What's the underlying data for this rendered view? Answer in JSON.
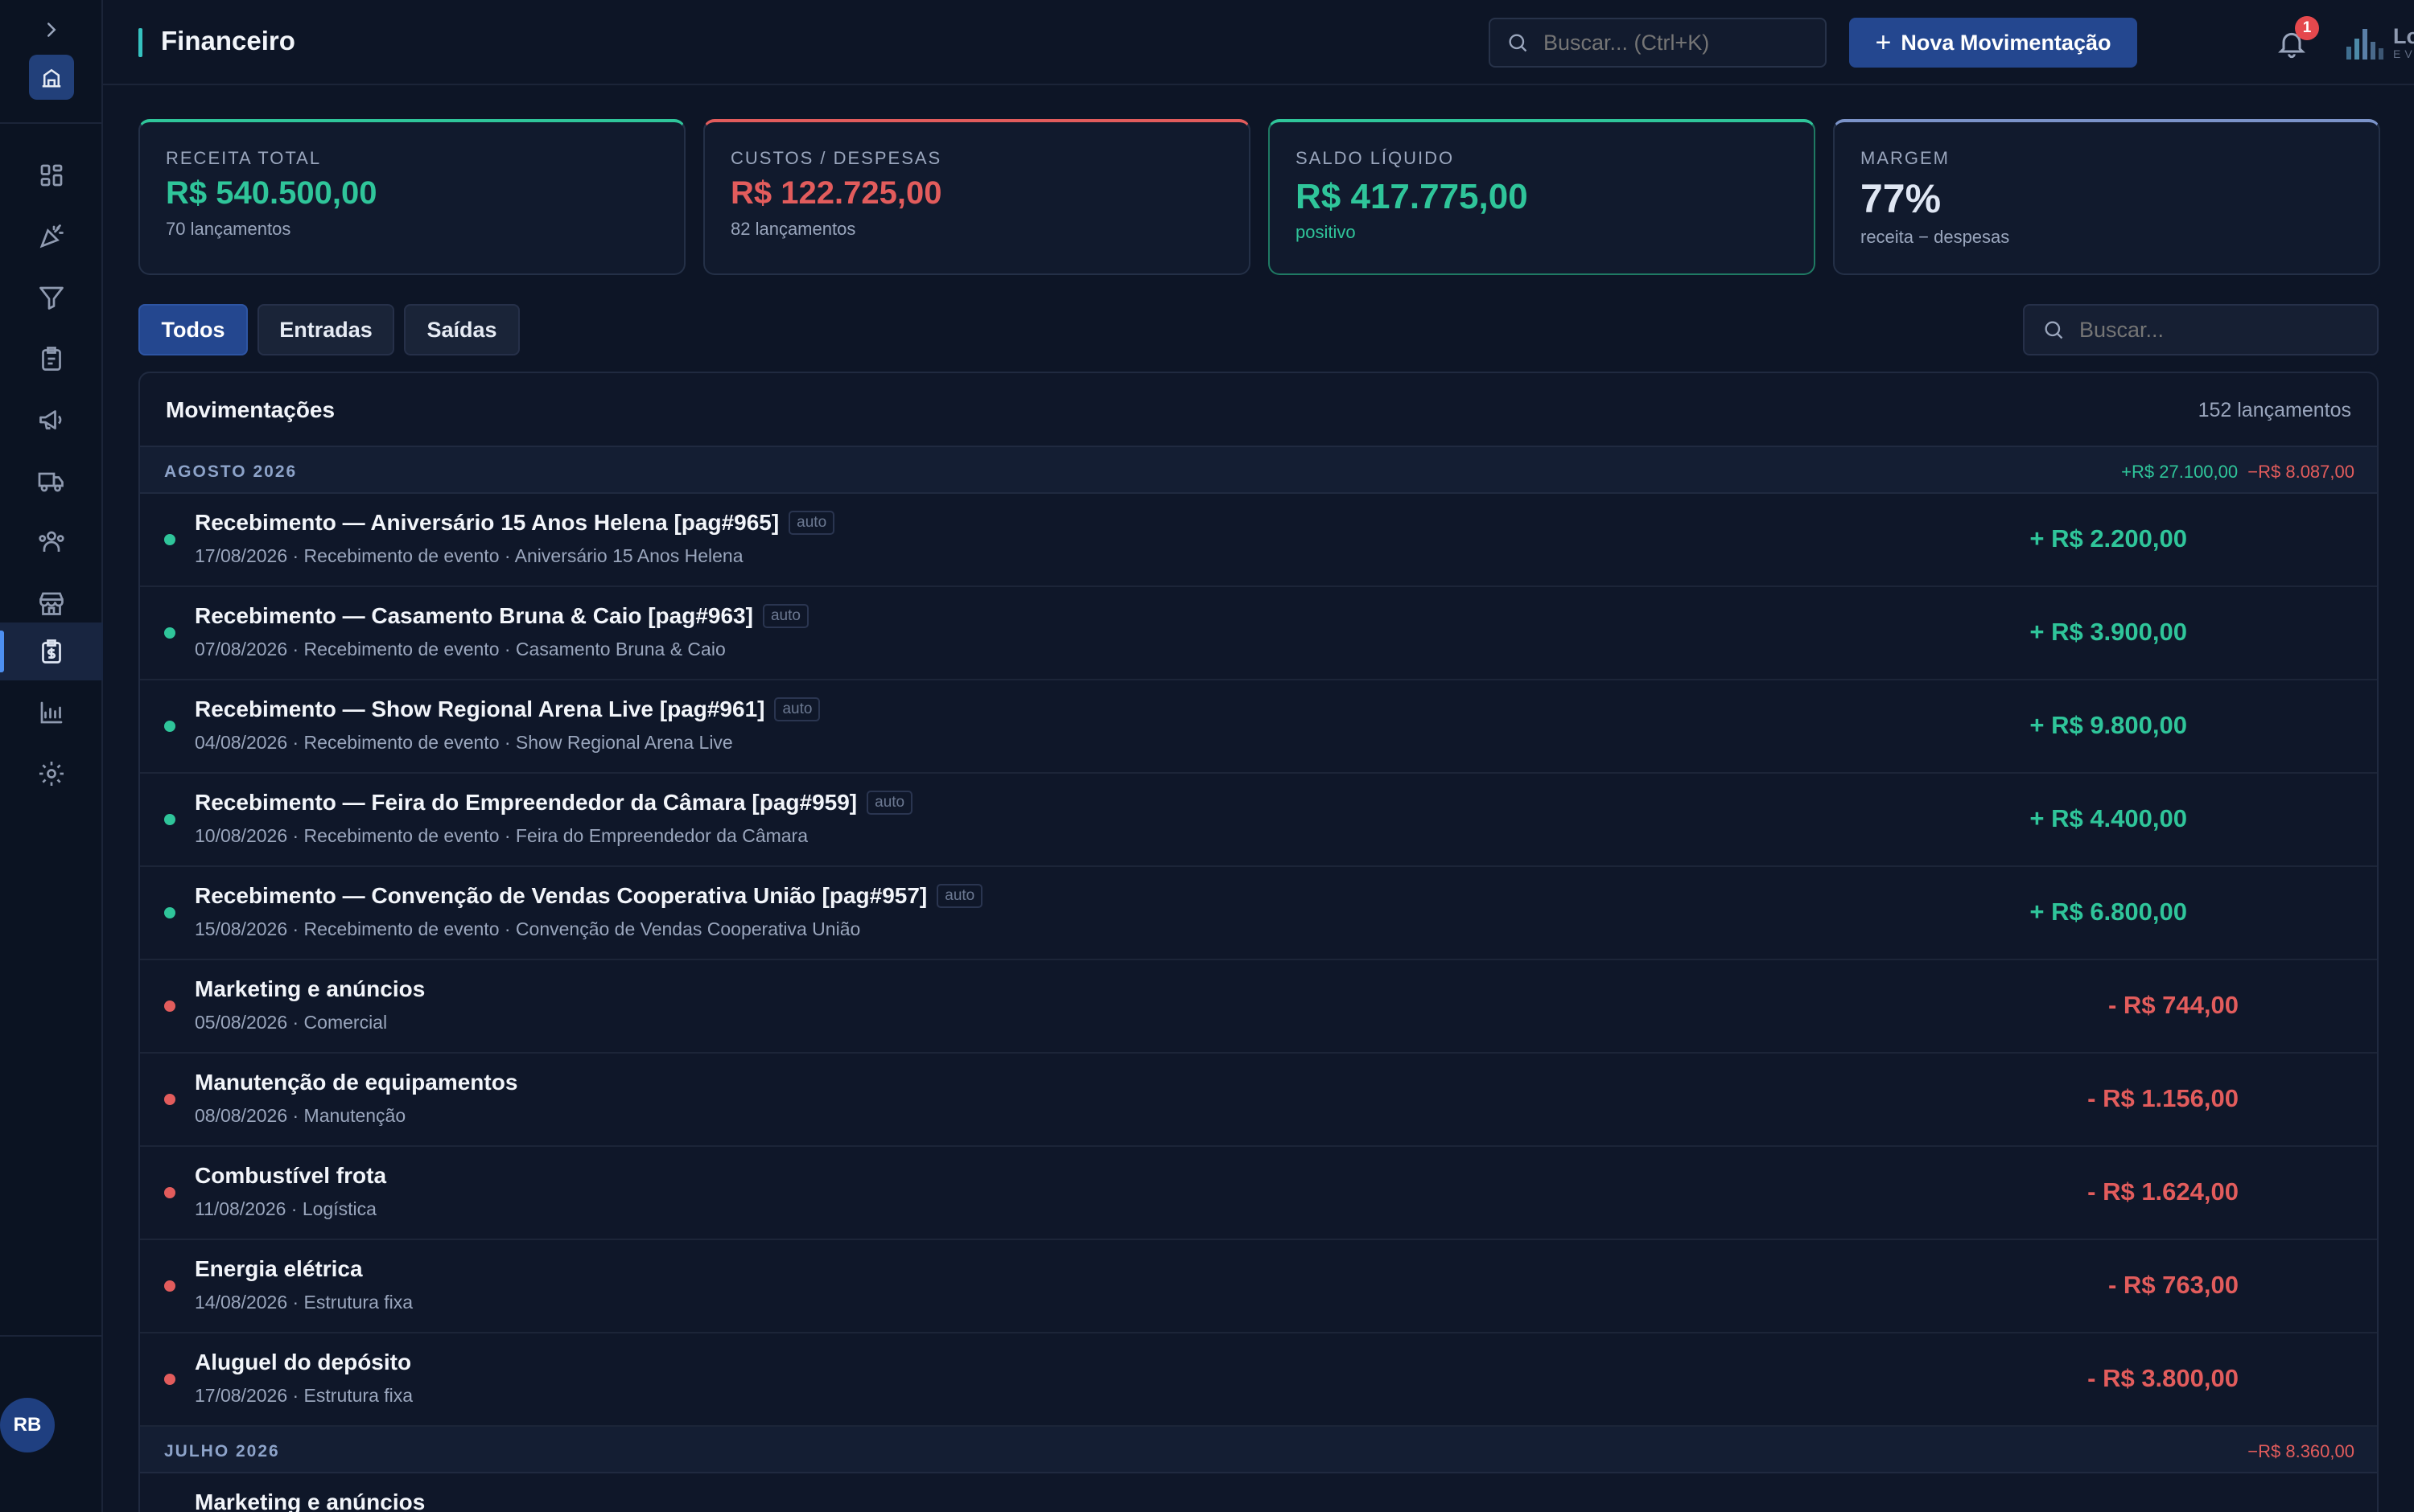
{
  "header": {
    "title": "Financeiro",
    "search_placeholder": "Buscar... (Ctrl+K)",
    "new_button_label": "Nova Movimentação",
    "notification_count": "1",
    "brand_name": "Locca",
    "brand_sub": "EVENTOS"
  },
  "sidebar": {
    "avatar_initials": "RB",
    "items": [
      {
        "icon": "dashboard-icon"
      },
      {
        "icon": "party-icon"
      },
      {
        "icon": "funnel-icon"
      },
      {
        "icon": "clipboard-icon"
      },
      {
        "icon": "megaphone-icon"
      },
      {
        "icon": "truck-icon"
      },
      {
        "icon": "users-icon"
      },
      {
        "icon": "store-icon"
      },
      {
        "icon": "finance-icon",
        "active": true
      },
      {
        "icon": "chart-icon"
      },
      {
        "icon": "gear-icon"
      }
    ]
  },
  "stats": {
    "revenue": {
      "label": "RECEITA TOTAL",
      "value": "R$ 540.500,00",
      "sub": "70 lançamentos"
    },
    "costs": {
      "label": "CUSTOS / DESPESAS",
      "value": "R$ 122.725,00",
      "sub": "82 lançamentos"
    },
    "balance": {
      "label": "SALDO LÍQUIDO",
      "value": "R$ 417.775,00",
      "sub": "positivo"
    },
    "margin": {
      "label": "MARGEM",
      "value": "77%",
      "sub": "receita − despesas"
    }
  },
  "filters": {
    "all": "Todos",
    "in": "Entradas",
    "out": "Saídas",
    "search_placeholder": "Buscar..."
  },
  "movements": {
    "title": "Movimentações",
    "count": "152 lançamentos",
    "groups": [
      {
        "label": "AGOSTO 2026",
        "total_in": "+R$ 27.100,00",
        "total_out": "−R$ 8.087,00",
        "rows": [
          {
            "title": "Recebimento — Aniversário 15 Anos Helena [pag#965]",
            "tag": "auto",
            "meta": "17/08/2026 · Recebimento de evento · Aniversário 15 Anos Helena",
            "amount": "+ R$ 2.200,00",
            "type": "in"
          },
          {
            "title": "Recebimento — Casamento Bruna & Caio [pag#963]",
            "tag": "auto",
            "meta": "07/08/2026 · Recebimento de evento · Casamento Bruna & Caio",
            "amount": "+ R$ 3.900,00",
            "type": "in"
          },
          {
            "title": "Recebimento — Show Regional Arena Live [pag#961]",
            "tag": "auto",
            "meta": "04/08/2026 · Recebimento de evento · Show Regional Arena Live",
            "amount": "+ R$ 9.800,00",
            "type": "in"
          },
          {
            "title": "Recebimento — Feira do Empreendedor da Câmara [pag#959]",
            "tag": "auto",
            "meta": "10/08/2026 · Recebimento de evento · Feira do Empreendedor da Câmara",
            "amount": "+ R$ 4.400,00",
            "type": "in"
          },
          {
            "title": "Recebimento — Convenção de Vendas Cooperativa União [pag#957]",
            "tag": "auto",
            "meta": "15/08/2026 · Recebimento de evento · Convenção de Vendas Cooperativa União",
            "amount": "+ R$ 6.800,00",
            "type": "in"
          },
          {
            "title": "Marketing e anúncios",
            "tag": "",
            "meta": "05/08/2026 · Comercial",
            "amount": "- R$ 744,00",
            "type": "out"
          },
          {
            "title": "Manutenção de equipamentos",
            "tag": "",
            "meta": "08/08/2026 · Manutenção",
            "amount": "- R$ 1.156,00",
            "type": "out"
          },
          {
            "title": "Combustível frota",
            "tag": "",
            "meta": "11/08/2026 · Logística",
            "amount": "- R$ 1.624,00",
            "type": "out"
          },
          {
            "title": "Energia elétrica",
            "tag": "",
            "meta": "14/08/2026 · Estrutura fixa",
            "amount": "- R$ 763,00",
            "type": "out"
          },
          {
            "title": "Aluguel do depósito",
            "tag": "",
            "meta": "17/08/2026 · Estrutura fixa",
            "amount": "- R$ 3.800,00",
            "type": "out"
          }
        ]
      },
      {
        "label": "JULHO 2026",
        "total_in": "",
        "total_out": "−R$ 8.360,00",
        "rows": [
          {
            "title": "Marketing e anúncios",
            "tag": "",
            "meta": "",
            "amount": "",
            "type": "out"
          }
        ]
      }
    ]
  }
}
